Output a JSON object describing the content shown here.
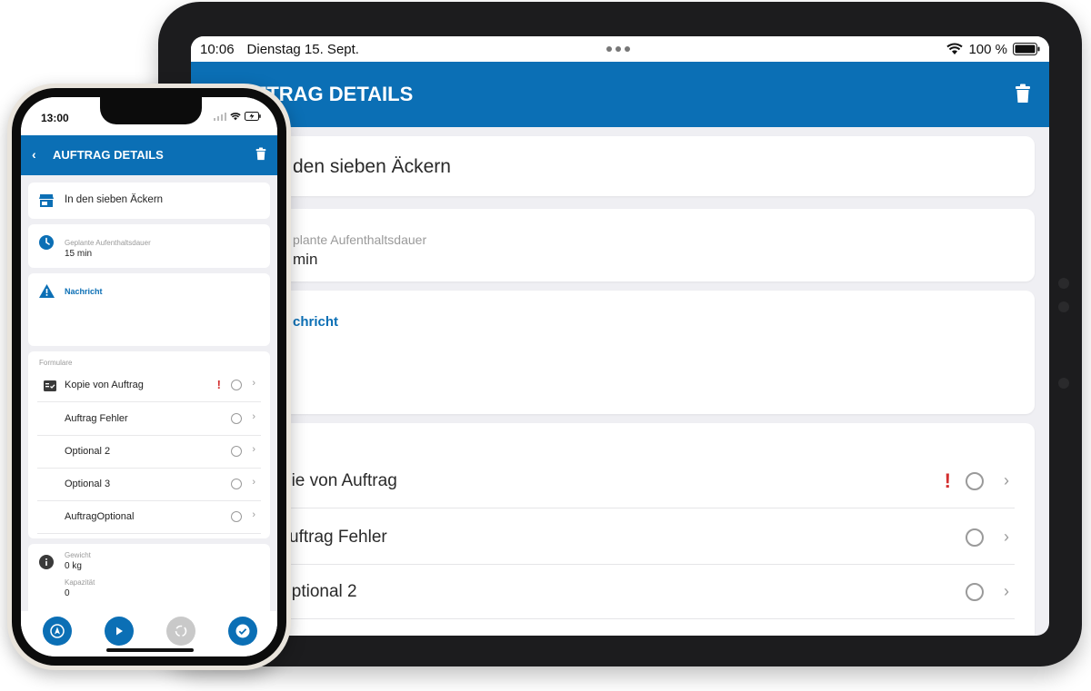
{
  "tablet": {
    "status": {
      "time": "10:06",
      "date": "Dienstag 15. Sept.",
      "battery": "100 %"
    },
    "appbar": {
      "title": "AUFTRAG DETAILS",
      "title_visible": "UFTRAG DETAILS"
    },
    "location": {
      "name_visible": "den sieben Äckern"
    },
    "duration": {
      "label_visible": "plante Aufenthaltsdauer",
      "value_visible": "min"
    },
    "message": {
      "label_visible": "chricht"
    },
    "forms": [
      {
        "label_visible": "pie von Auftrag",
        "warning": true
      },
      {
        "label_visible": "uftrag Fehler",
        "warning": false
      },
      {
        "label_visible": "Optional 2",
        "warning": false
      }
    ]
  },
  "phone": {
    "status": {
      "time": "13:00"
    },
    "appbar": {
      "back": "‹",
      "title": "AUFTRAG DETAILS"
    },
    "location": {
      "name": "In den sieben Äckern"
    },
    "duration": {
      "label": "Geplante Aufenthaltsdauer",
      "value": "15 min"
    },
    "message": {
      "label": "Nachricht"
    },
    "forms_header": "Formulare",
    "forms": [
      {
        "label": "Kopie von Auftrag",
        "warning": true
      },
      {
        "label": "Auftrag Fehler",
        "warning": false
      },
      {
        "label": "Optional 2",
        "warning": false
      },
      {
        "label": "Optional 3",
        "warning": false
      },
      {
        "label": "AuftragOptional",
        "warning": false
      }
    ],
    "info": {
      "weight_label": "Gewicht",
      "weight_value": "0 kg",
      "capacity_label": "Kapazität",
      "capacity_value": "0"
    },
    "warning_mark": "!",
    "chevron": "›"
  },
  "colors": {
    "primary": "#0b6fb5",
    "warning": "#d32f2f",
    "background": "#efeff3"
  }
}
